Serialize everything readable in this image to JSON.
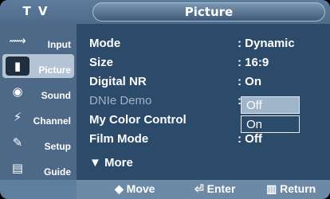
{
  "header": {
    "tv_label": "T V",
    "title": "Picture"
  },
  "sidebar": {
    "items": [
      {
        "label": "Input",
        "icon": "input-icon"
      },
      {
        "label": "Picture",
        "icon": "picture-icon",
        "active": true
      },
      {
        "label": "Sound",
        "icon": "sound-icon"
      },
      {
        "label": "Channel",
        "icon": "channel-icon"
      },
      {
        "label": "Setup",
        "icon": "setup-icon"
      },
      {
        "label": "Guide",
        "icon": "guide-icon"
      }
    ]
  },
  "menu": {
    "rows": [
      {
        "key": "Mode",
        "value": ": Dynamic"
      },
      {
        "key": "Size",
        "value": ": 16:9"
      },
      {
        "key": "Digital NR",
        "value": ": On"
      },
      {
        "key": "DNIe Demo",
        "value": ":"
      },
      {
        "key": "My Color Control",
        "value": ""
      },
      {
        "key": "Film Mode",
        "value": ": Off"
      }
    ],
    "more": "▼ More"
  },
  "dropdown": {
    "options": [
      "Off",
      "On"
    ],
    "selected": "Off"
  },
  "footer": {
    "move": "◆ Move",
    "enter": "Enter",
    "return": "Return"
  }
}
